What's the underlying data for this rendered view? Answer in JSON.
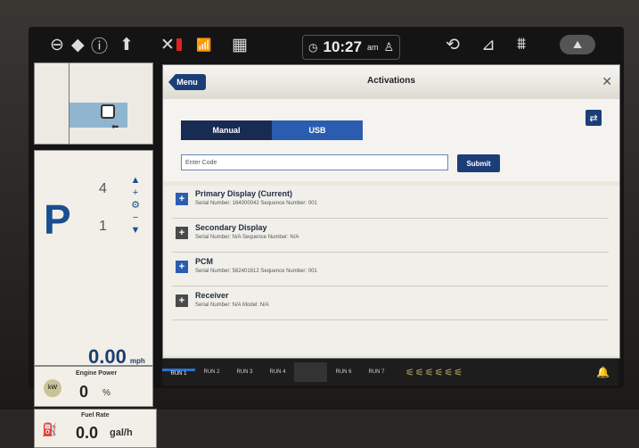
{
  "status_bar": {
    "time": "10:27",
    "ampm": "am",
    "icons": [
      "no-entry-icon",
      "diamond-direction-icon",
      "info-icon",
      "up-arrow-icon",
      "tools-warning-icon",
      "signal-icon",
      "grid-icon",
      "clock-icon",
      "user-icon",
      "steering-icon",
      "equipment-icon",
      "tractor-icon",
      "road-icon"
    ]
  },
  "left_panel": {
    "gear": "P",
    "gear_up": "4",
    "gear_down": "1",
    "speed": "0.00",
    "speed_unit": "mph",
    "engine_power_label": "Engine Power",
    "engine_power_value": "0",
    "engine_power_unit": "%",
    "fuel_rate_label": "Fuel Rate",
    "fuel_rate_value": "0.0",
    "fuel_rate_unit": "gal/h"
  },
  "dialog": {
    "menu_label": "Menu",
    "title": "Activations",
    "toggle": {
      "manual": "Manual",
      "usb": "USB"
    },
    "input_placeholder": "Enter Code",
    "submit_label": "Submit",
    "items": [
      {
        "title": "Primary Display (Current)",
        "subtitle": "Serial Number: 164000042   Sequence Number: 001",
        "icon_color": "#2a5db0"
      },
      {
        "title": "Secondary Display",
        "subtitle": "Serial Number: N/A   Sequence Number: N/A",
        "icon_color": "#4a4a4a"
      },
      {
        "title": "PCM",
        "subtitle": "Serial Number: 582401612   Sequence Number: 001",
        "icon_color": "#2a5db0"
      },
      {
        "title": "Receiver",
        "subtitle": "Serial Number: N/A   Model: N/A",
        "icon_color": "#4a4a4a"
      }
    ]
  },
  "bottom_tabs": [
    "RUN 1",
    "RUN 2",
    "RUN 3",
    "RUN 4",
    "",
    "RUN 6",
    "RUN 7"
  ],
  "colors": {
    "accent": "#1c3e78",
    "highlight": "#2a5db0",
    "active_tab": "#2b6fd6"
  }
}
